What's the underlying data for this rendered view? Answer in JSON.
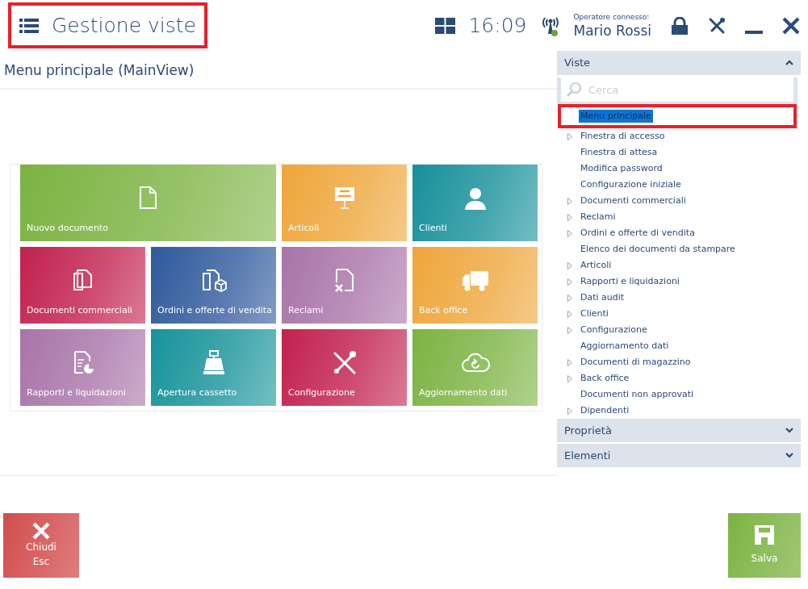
{
  "header": {
    "title": "Gestione viste",
    "annotated": true,
    "time": "16:09",
    "operator_label": "Operatore connesso:",
    "operator_name": "Mario Rossi"
  },
  "view_title": "Menu principale (MainView)",
  "tiles": [
    {
      "label": "Nuovo documento",
      "color": "#7cb342",
      "wide": true
    },
    {
      "label": "Articoli",
      "color": "#eea63a",
      "wide": false
    },
    {
      "label": "Clienti",
      "color": "#17909a",
      "wide": false
    },
    {
      "label": "Documenti commerciali",
      "color": "#c2214e",
      "wide": false
    },
    {
      "label": "Ordini e offerte di vendita",
      "color": "#2f5a9c",
      "wide": false
    },
    {
      "label": "Reclami",
      "color": "#a874a8",
      "wide": false
    },
    {
      "label": "Back office",
      "color": "#eea63a",
      "wide": false
    },
    {
      "label": "Rapporti e liquidazioni",
      "color": "#a874a8",
      "wide": false
    },
    {
      "label": "Apertura cassetto",
      "color": "#17939a",
      "wide": false
    },
    {
      "label": "Configurazione",
      "color": "#c2214e",
      "wide": false
    },
    {
      "label": "Aggiornamento dati",
      "color": "#7cb342",
      "wide": false
    }
  ],
  "panels": [
    {
      "title": "Viste",
      "expanded": true,
      "search": {
        "placeholder": "Cerca"
      },
      "items": [
        {
          "label": "Menu principale",
          "expandable": false,
          "selected": true,
          "annotated": true
        },
        {
          "label": "Finestra di accesso",
          "expandable": true,
          "selected": false,
          "annotated": false
        },
        {
          "label": "Finestra di attesa",
          "expandable": false,
          "selected": false,
          "annotated": false
        },
        {
          "label": "Modifica password",
          "expandable": false,
          "selected": false,
          "annotated": false
        },
        {
          "label": "Configurazione iniziale",
          "expandable": false,
          "selected": false,
          "annotated": false
        },
        {
          "label": "Documenti commerciali",
          "expandable": true,
          "selected": false,
          "annotated": false
        },
        {
          "label": "Reclami",
          "expandable": true,
          "selected": false,
          "annotated": false
        },
        {
          "label": "Ordini e offerte di vendita",
          "expandable": true,
          "selected": false,
          "annotated": false
        },
        {
          "label": "Elenco dei documenti da stampare",
          "expandable": false,
          "selected": false,
          "annotated": false
        },
        {
          "label": "Articoli",
          "expandable": true,
          "selected": false,
          "annotated": false
        },
        {
          "label": "Rapporti e liquidazioni",
          "expandable": true,
          "selected": false,
          "annotated": false
        },
        {
          "label": "Dati audit",
          "expandable": true,
          "selected": false,
          "annotated": false
        },
        {
          "label": "Clienti",
          "expandable": true,
          "selected": false,
          "annotated": false
        },
        {
          "label": "Configurazione",
          "expandable": true,
          "selected": false,
          "annotated": false
        },
        {
          "label": "Aggiornamento dati",
          "expandable": false,
          "selected": false,
          "annotated": false
        },
        {
          "label": "Documenti di magazzino",
          "expandable": true,
          "selected": false,
          "annotated": false
        },
        {
          "label": "Back office",
          "expandable": true,
          "selected": false,
          "annotated": false
        },
        {
          "label": "Documenti non approvati",
          "expandable": false,
          "selected": false,
          "annotated": false
        },
        {
          "label": "Dipendenti",
          "expandable": true,
          "selected": false,
          "annotated": false
        }
      ]
    },
    {
      "title": "Proprietà",
      "expanded": false
    },
    {
      "title": "Elementi",
      "expanded": false
    }
  ],
  "buttons": [
    {
      "kind": "close",
      "label": "Chiudi",
      "shortcut": "Esc",
      "color": "#d24d4d"
    },
    {
      "kind": "save",
      "label": "Salva",
      "color": "#7cb342"
    }
  ]
}
